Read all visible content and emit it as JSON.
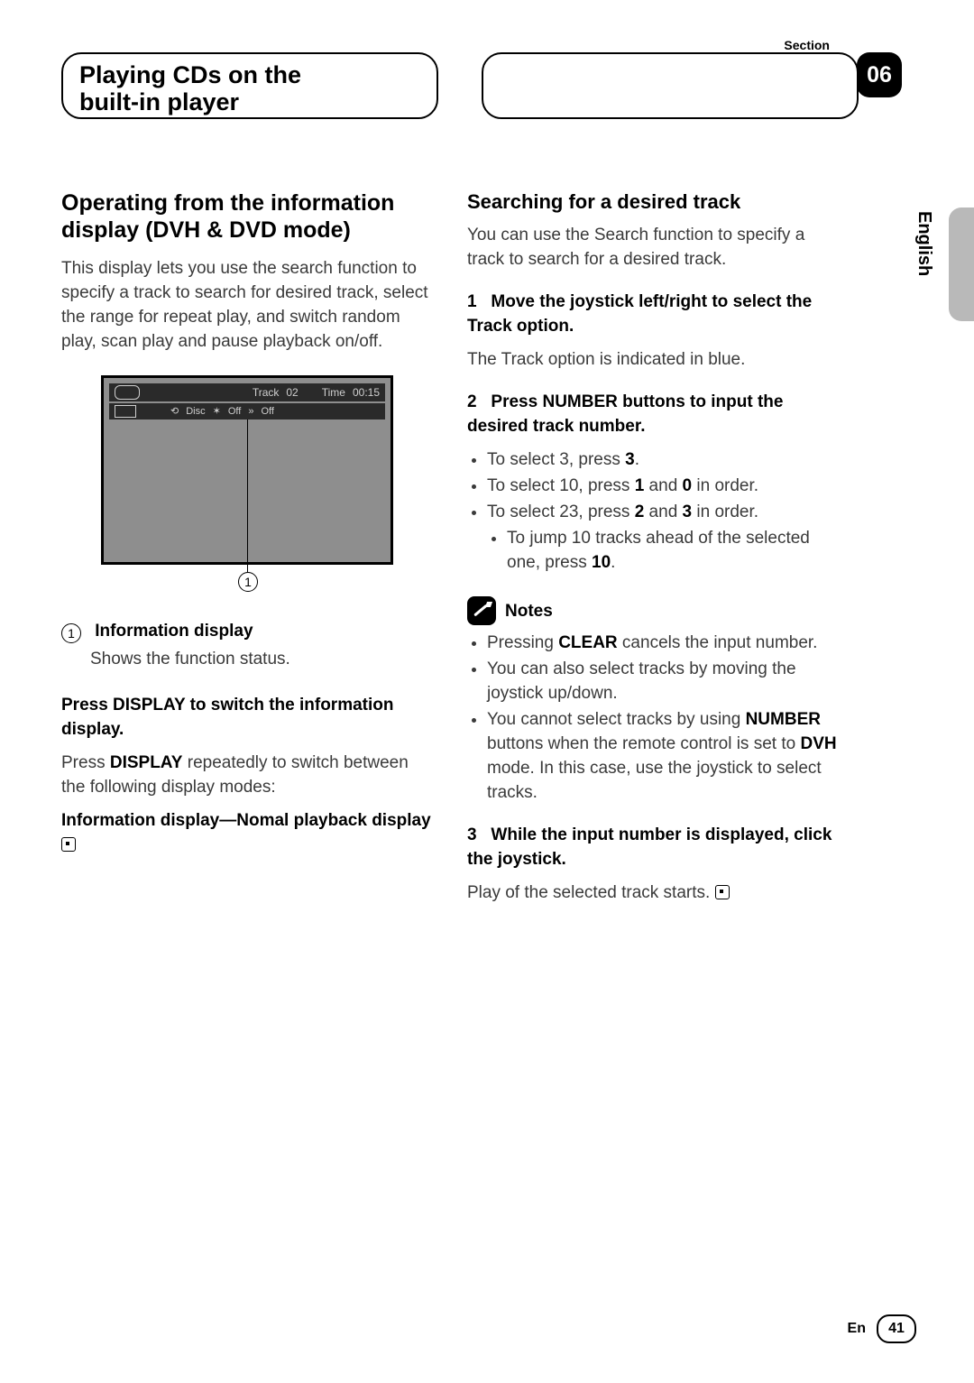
{
  "header": {
    "section_label": "Section",
    "section_number": "06",
    "title_line1": "Playing CDs on the",
    "title_line2": "built-in player"
  },
  "side": {
    "language": "English"
  },
  "left": {
    "heading_line1": "Operating from the information",
    "heading_line2": "display (DVH & DVD mode)",
    "intro": "This display lets you use the search function to specify a track to search for desired track, select the range for repeat play, and switch random play, scan play and pause playback on/off.",
    "display": {
      "track_label": "Track",
      "track_value": "02",
      "time_label": "Time",
      "time_value": "00:15",
      "repeat_label": "Disc",
      "random_label": "Off",
      "scan_label": "Off"
    },
    "callout": {
      "num": "1",
      "label": "Information display",
      "desc": "Shows the function status."
    },
    "press": {
      "title": "Press DISPLAY to switch the information display.",
      "body_pre": "Press ",
      "body_bold": "DISPLAY",
      "body_post": " repeatedly to switch between the following display modes:",
      "modes": "Information display—Nomal playback display"
    }
  },
  "right": {
    "heading": "Searching for a desired track",
    "intro": "You can use the Search function to specify a track to search for a desired track.",
    "step1": {
      "num": "1",
      "title": "Move the joystick left/right to select the Track option.",
      "body": "The Track option is indicated in blue."
    },
    "step2": {
      "num": "2",
      "title_pre": "Press ",
      "title_bold": "NUMBER",
      "title_post": " buttons to input the desired track number.",
      "b1_pre": "To select 3, press ",
      "b1_bold": "3",
      "b1_post": ".",
      "b2_pre": "To select 10, press ",
      "b2_bold1": "1",
      "b2_mid": " and ",
      "b2_bold2": "0",
      "b2_post": " in order.",
      "b3_pre": "To select 23, press ",
      "b3_bold1": "2",
      "b3_mid": " and ",
      "b3_bold2": "3",
      "b3_post": " in order.",
      "b3s_pre": "To jump 10 tracks ahead of the selected one, press ",
      "b3s_bold": "10",
      "b3s_post": "."
    },
    "notes": {
      "title": "Notes",
      "n1_pre": "Pressing ",
      "n1_bold": "CLEAR",
      "n1_post": " cancels the input number.",
      "n2": "You can also select tracks by moving the joystick up/down.",
      "n3_pre": "You cannot select tracks by using ",
      "n3_bold1": "NUMBER",
      "n3_mid": " buttons when the remote control is set to ",
      "n3_bold2": "DVH",
      "n3_post": " mode. In this case, use the joystick to select tracks."
    },
    "step3": {
      "num": "3",
      "title": "While the input number is displayed, click the joystick.",
      "body": "Play of the selected track starts."
    }
  },
  "footer": {
    "lang_code": "En",
    "page": "41"
  }
}
